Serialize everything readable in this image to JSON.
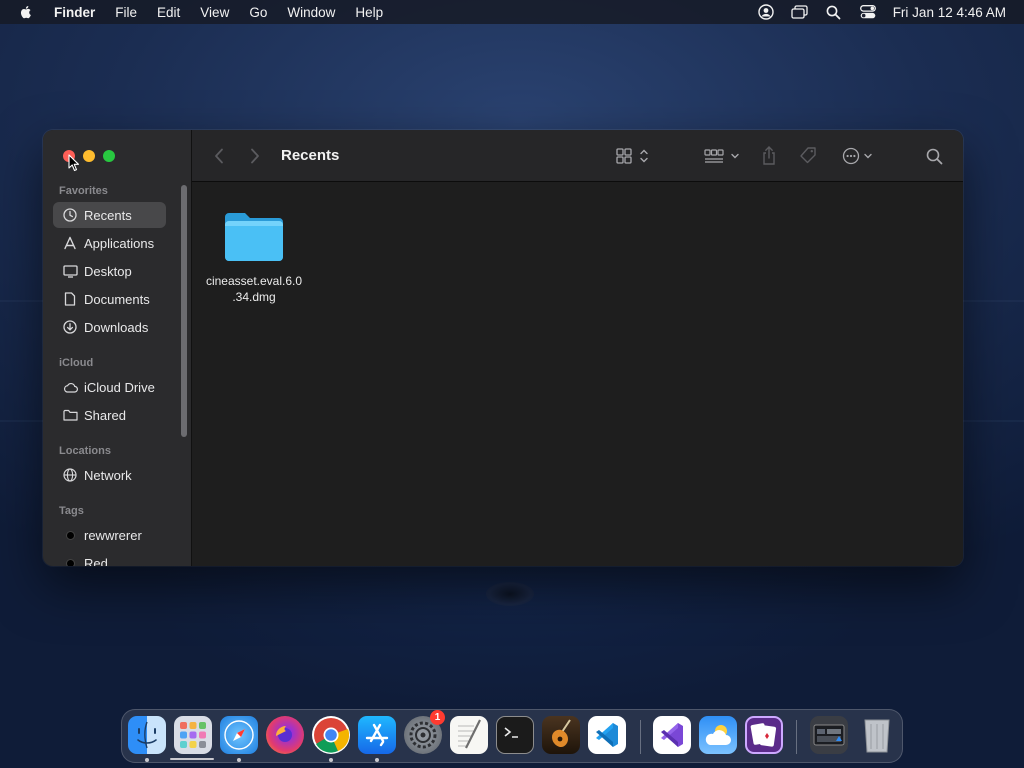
{
  "menubar": {
    "app_name": "Finder",
    "menus": [
      "File",
      "Edit",
      "View",
      "Go",
      "Window",
      "Help"
    ],
    "clock": "Fri Jan 12  4:46 AM"
  },
  "window": {
    "title": "Recents",
    "sidebar": {
      "sections": {
        "favorites": "Favorites",
        "icloud": "iCloud",
        "locations": "Locations",
        "tags": "Tags"
      },
      "favorites": [
        "Recents",
        "Applications",
        "Desktop",
        "Documents",
        "Downloads"
      ],
      "icloud": [
        "iCloud Drive",
        "Shared"
      ],
      "locations": [
        "Network"
      ],
      "tags": [
        "rewwrerer",
        "Red"
      ],
      "selected": "Recents"
    },
    "files": [
      {
        "name": "cineasset.eval.6.0.34.dmg",
        "line1": "cineasset.eval.6.0",
        "line2": ".34.dmg",
        "icon": "folder-icon"
      }
    ]
  },
  "dock": {
    "apps": [
      "Finder",
      "Launchpad",
      "Safari",
      "Firefox",
      "Chrome",
      "App Store",
      "System Settings",
      "TextEdit",
      "Terminal",
      "GarageBand",
      "Visual Studio Code",
      "Visual Studio",
      "Weather",
      "Solitaire",
      "Screenshot",
      "Trash"
    ],
    "badge": "1"
  },
  "colors": {
    "accent_folder": "#3fb6f2",
    "close": "#fe5f57",
    "minimize": "#febc2e",
    "maximize": "#28c840"
  }
}
